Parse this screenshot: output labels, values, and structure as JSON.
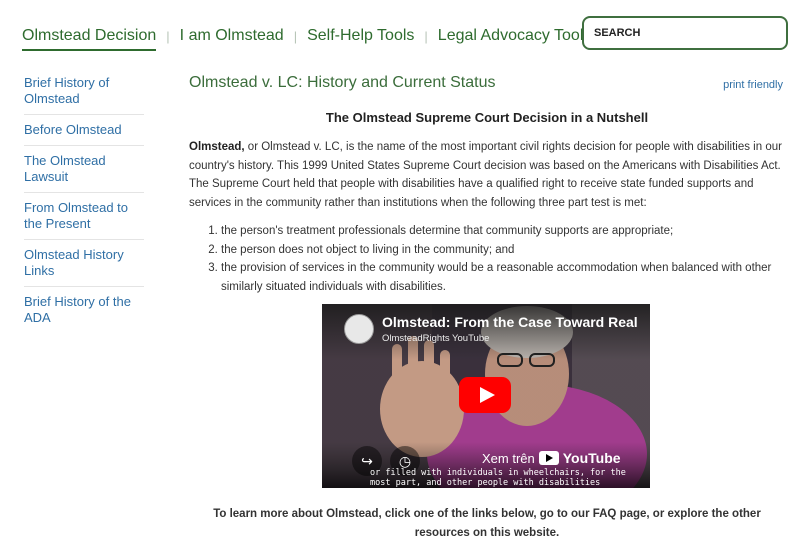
{
  "topnav": {
    "items": [
      {
        "label": "Olmstead Decision",
        "active": true
      },
      {
        "label": "I am Olmstead"
      },
      {
        "label": "Self-Help Tools"
      },
      {
        "label": "Legal Advocacy Tools"
      }
    ]
  },
  "search": {
    "placeholder": "SEARCH"
  },
  "sidebar": {
    "items": [
      {
        "label": "Brief History of Olmstead"
      },
      {
        "label": "Before Olmstead"
      },
      {
        "label": "The Olmstead Lawsuit"
      },
      {
        "label": "From Olmstead to the Present"
      },
      {
        "label": "Olmstead History Links"
      },
      {
        "label": "Brief History of the ADA"
      }
    ]
  },
  "main": {
    "title": "Olmstead v. LC: History and Current Status",
    "print_label": "print friendly",
    "section_title": "The Olmstead Supreme Court Decision in a Nutshell",
    "intro_bold": "Olmstead,",
    "intro_text": " or Olmstead v. LC, is the name of the most important civil rights decision for people with disabilities in our country's history. This 1999 United States Supreme Court decision was based on the Americans with Disabilities Act.  The Supreme Court held that people with disabilities have a qualified right to receive state funded supports and services in the community rather than institutions when the following three part test is met:",
    "criteria": [
      "the person's treatment professionals determine that community supports are appropriate;",
      "the person does not object to living in the community; and",
      "the provision of services in the community would be a reasonable accommodation when balanced with other similarly situated individuals with disabilities."
    ],
    "learn_more": "To learn more about Olmstead, click one of the links below, go to our FAQ page, or explore the other resources on this website."
  },
  "video": {
    "title": "Olmstead: From the Case Toward Real",
    "channel": "OlmsteadRights YouTube",
    "watch_label": "Xem trên",
    "platform": "YouTube",
    "caption": "or filled with individuals in wheelchairs, for the\nmost part, and other people with disabilities"
  }
}
